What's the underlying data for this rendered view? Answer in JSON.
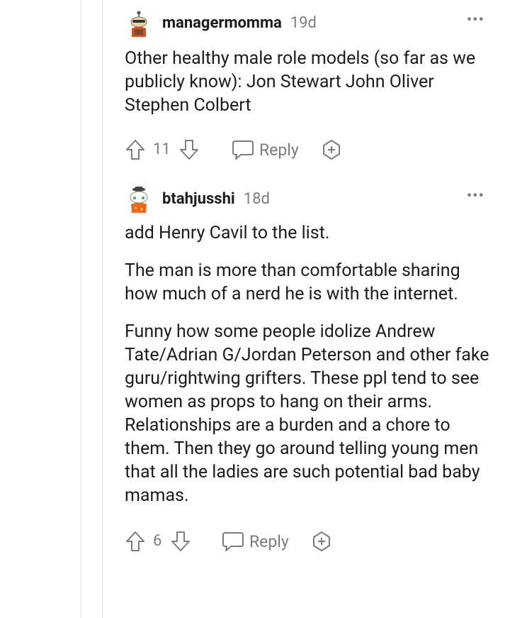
{
  "comments": [
    {
      "username": "managermomma",
      "time": "19d",
      "more_icon": "more-horizontal-icon",
      "paragraphs": [
        "Other healthy male role models (so far as we publicly know): Jon Stewart John Oliver Stephen Colbert"
      ],
      "score": "11",
      "reply_label": "Reply"
    },
    {
      "username": "btahjusshi",
      "time": "18d",
      "more_icon": "more-horizontal-icon",
      "paragraphs": [
        "add Henry Cavil to the list.",
        "The man is more than comfortable sharing how much of a nerd he is with the internet.",
        "Funny how some people idolize Andrew Tate/Adrian G/Jordan Peterson and other fake guru/rightwing grifters. These ppl tend to see women as props to hang on their arms. Relationships are a burden and a chore to them. Then they go around telling young men that all the ladies are such potential bad baby mamas."
      ],
      "score": "6",
      "reply_label": "Reply"
    }
  ],
  "colors": {
    "meta": "#7c7c7c",
    "text": "#1c1c1c",
    "thread_line": "#edeff1"
  }
}
